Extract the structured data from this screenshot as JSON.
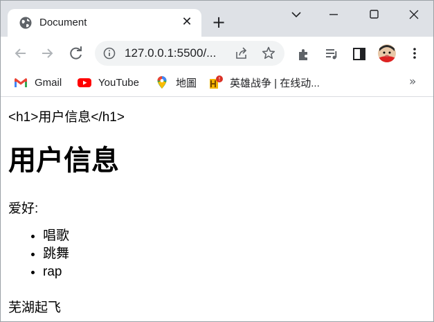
{
  "browser": {
    "tab": {
      "title": "Document",
      "favicon": "globe-icon"
    },
    "address_bar": {
      "url": "127.0.0.1:5500/..."
    },
    "bookmarks": [
      {
        "label": "Gmail",
        "icon": "gmail-icon"
      },
      {
        "label": "YouTube",
        "icon": "youtube-icon"
      },
      {
        "label": "地圖",
        "icon": "maps-pin-icon"
      },
      {
        "label": "英雄战争 | 在线动...",
        "icon": "game-icon"
      }
    ],
    "colors": {
      "tabstrip": "#dee1e6",
      "omnibox": "#f1f3f4",
      "youtube_red": "#ff0000"
    }
  },
  "page": {
    "code_line": "<h1>用户信息</h1>",
    "heading": "用户信息",
    "hobby_label": "爱好:",
    "hobbies": [
      "唱歌",
      "跳舞",
      "rap"
    ],
    "footer_text": "芜湖起飞"
  }
}
